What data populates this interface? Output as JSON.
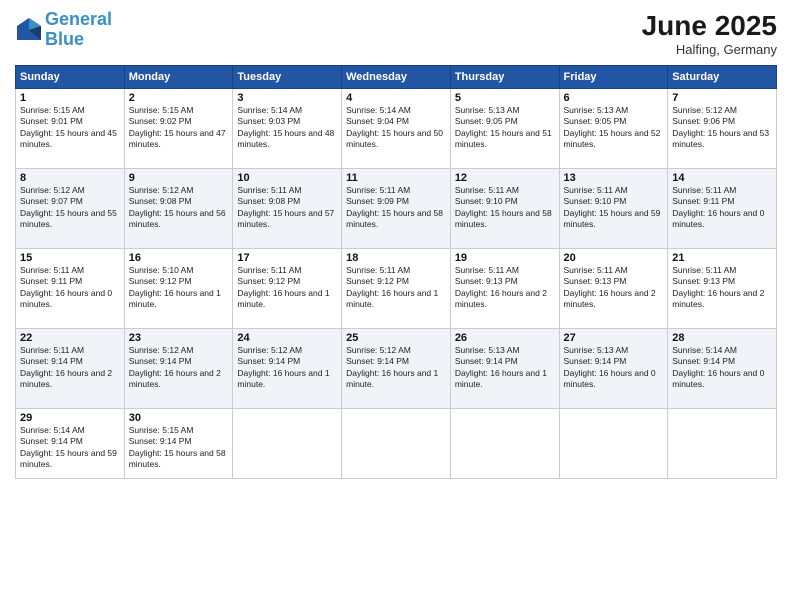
{
  "header": {
    "logo_line1": "General",
    "logo_line2": "Blue",
    "month": "June 2025",
    "location": "Halfing, Germany"
  },
  "weekdays": [
    "Sunday",
    "Monday",
    "Tuesday",
    "Wednesday",
    "Thursday",
    "Friday",
    "Saturday"
  ],
  "weeks": [
    [
      {
        "day": "1",
        "sunrise": "5:15 AM",
        "sunset": "9:01 PM",
        "daylight": "15 hours and 45 minutes."
      },
      {
        "day": "2",
        "sunrise": "5:15 AM",
        "sunset": "9:02 PM",
        "daylight": "15 hours and 47 minutes."
      },
      {
        "day": "3",
        "sunrise": "5:14 AM",
        "sunset": "9:03 PM",
        "daylight": "15 hours and 48 minutes."
      },
      {
        "day": "4",
        "sunrise": "5:14 AM",
        "sunset": "9:04 PM",
        "daylight": "15 hours and 50 minutes."
      },
      {
        "day": "5",
        "sunrise": "5:13 AM",
        "sunset": "9:05 PM",
        "daylight": "15 hours and 51 minutes."
      },
      {
        "day": "6",
        "sunrise": "5:13 AM",
        "sunset": "9:05 PM",
        "daylight": "15 hours and 52 minutes."
      },
      {
        "day": "7",
        "sunrise": "5:12 AM",
        "sunset": "9:06 PM",
        "daylight": "15 hours and 53 minutes."
      }
    ],
    [
      {
        "day": "8",
        "sunrise": "5:12 AM",
        "sunset": "9:07 PM",
        "daylight": "15 hours and 55 minutes."
      },
      {
        "day": "9",
        "sunrise": "5:12 AM",
        "sunset": "9:08 PM",
        "daylight": "15 hours and 56 minutes."
      },
      {
        "day": "10",
        "sunrise": "5:11 AM",
        "sunset": "9:08 PM",
        "daylight": "15 hours and 57 minutes."
      },
      {
        "day": "11",
        "sunrise": "5:11 AM",
        "sunset": "9:09 PM",
        "daylight": "15 hours and 58 minutes."
      },
      {
        "day": "12",
        "sunrise": "5:11 AM",
        "sunset": "9:10 PM",
        "daylight": "15 hours and 58 minutes."
      },
      {
        "day": "13",
        "sunrise": "5:11 AM",
        "sunset": "9:10 PM",
        "daylight": "15 hours and 59 minutes."
      },
      {
        "day": "14",
        "sunrise": "5:11 AM",
        "sunset": "9:11 PM",
        "daylight": "16 hours and 0 minutes."
      }
    ],
    [
      {
        "day": "15",
        "sunrise": "5:11 AM",
        "sunset": "9:11 PM",
        "daylight": "16 hours and 0 minutes."
      },
      {
        "day": "16",
        "sunrise": "5:10 AM",
        "sunset": "9:12 PM",
        "daylight": "16 hours and 1 minute."
      },
      {
        "day": "17",
        "sunrise": "5:11 AM",
        "sunset": "9:12 PM",
        "daylight": "16 hours and 1 minute."
      },
      {
        "day": "18",
        "sunrise": "5:11 AM",
        "sunset": "9:12 PM",
        "daylight": "16 hours and 1 minute."
      },
      {
        "day": "19",
        "sunrise": "5:11 AM",
        "sunset": "9:13 PM",
        "daylight": "16 hours and 2 minutes."
      },
      {
        "day": "20",
        "sunrise": "5:11 AM",
        "sunset": "9:13 PM",
        "daylight": "16 hours and 2 minutes."
      },
      {
        "day": "21",
        "sunrise": "5:11 AM",
        "sunset": "9:13 PM",
        "daylight": "16 hours and 2 minutes."
      }
    ],
    [
      {
        "day": "22",
        "sunrise": "5:11 AM",
        "sunset": "9:14 PM",
        "daylight": "16 hours and 2 minutes."
      },
      {
        "day": "23",
        "sunrise": "5:12 AM",
        "sunset": "9:14 PM",
        "daylight": "16 hours and 2 minutes."
      },
      {
        "day": "24",
        "sunrise": "5:12 AM",
        "sunset": "9:14 PM",
        "daylight": "16 hours and 1 minute."
      },
      {
        "day": "25",
        "sunrise": "5:12 AM",
        "sunset": "9:14 PM",
        "daylight": "16 hours and 1 minute."
      },
      {
        "day": "26",
        "sunrise": "5:13 AM",
        "sunset": "9:14 PM",
        "daylight": "16 hours and 1 minute."
      },
      {
        "day": "27",
        "sunrise": "5:13 AM",
        "sunset": "9:14 PM",
        "daylight": "16 hours and 0 minutes."
      },
      {
        "day": "28",
        "sunrise": "5:14 AM",
        "sunset": "9:14 PM",
        "daylight": "16 hours and 0 minutes."
      }
    ],
    [
      {
        "day": "29",
        "sunrise": "5:14 AM",
        "sunset": "9:14 PM",
        "daylight": "15 hours and 59 minutes."
      },
      {
        "day": "30",
        "sunrise": "5:15 AM",
        "sunset": "9:14 PM",
        "daylight": "15 hours and 58 minutes."
      },
      null,
      null,
      null,
      null,
      null
    ]
  ]
}
